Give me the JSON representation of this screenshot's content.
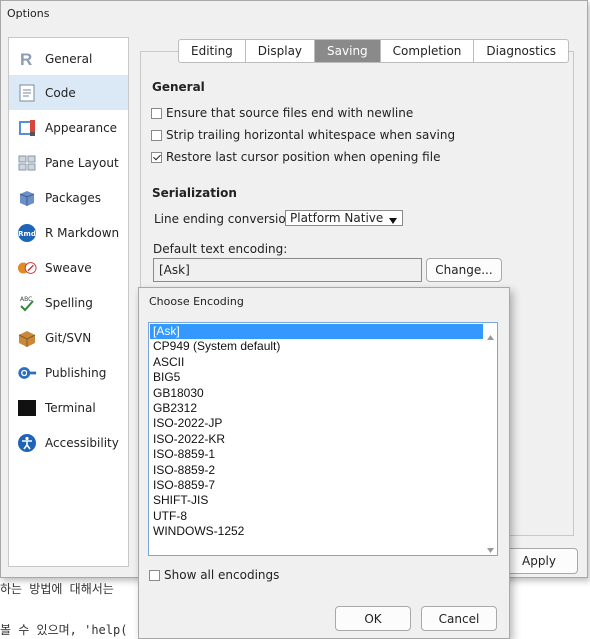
{
  "background": {
    "line1": "하는 방법에 대해서는",
    "line2": "볼 수 있으며, 'help("
  },
  "options": {
    "title": "Options",
    "sidebar": [
      {
        "label": "General",
        "icon": "r-logo-icon"
      },
      {
        "label": "Code",
        "icon": "code-document-icon"
      },
      {
        "label": "Appearance",
        "icon": "appearance-icon"
      },
      {
        "label": "Pane Layout",
        "icon": "pane-layout-icon"
      },
      {
        "label": "Packages",
        "icon": "packages-icon"
      },
      {
        "label": "R Markdown",
        "icon": "rmd-icon"
      },
      {
        "label": "Sweave",
        "icon": "sweave-icon"
      },
      {
        "label": "Spelling",
        "icon": "spelling-icon"
      },
      {
        "label": "Git/SVN",
        "icon": "git-svn-icon"
      },
      {
        "label": "Publishing",
        "icon": "publishing-icon"
      },
      {
        "label": "Terminal",
        "icon": "terminal-icon"
      },
      {
        "label": "Accessibility",
        "icon": "accessibility-icon"
      }
    ],
    "active_sidebar": "Code",
    "tabs": [
      "Editing",
      "Display",
      "Saving",
      "Completion",
      "Diagnostics"
    ],
    "active_tab": "Saving",
    "general": {
      "heading": "General",
      "checkboxes": [
        {
          "label": "Ensure that source files end with newline",
          "checked": false
        },
        {
          "label": "Strip trailing horizontal whitespace when saving",
          "checked": false
        },
        {
          "label": "Restore last cursor position when opening file",
          "checked": true
        }
      ]
    },
    "serialization": {
      "heading": "Serialization",
      "line_ending_label": "Line ending conversion:",
      "line_ending_value": "Platform Native",
      "encoding_label": "Default text encoding:",
      "encoding_value": "[Ask]",
      "change_label": "Change..."
    },
    "apply_label": "Apply"
  },
  "encoding_dialog": {
    "title": "Choose Encoding",
    "items": [
      "[Ask]",
      "CP949 (System default)",
      "ASCII",
      "BIG5",
      "GB18030",
      "GB2312",
      "ISO-2022-JP",
      "ISO-2022-KR",
      "ISO-8859-1",
      "ISO-8859-2",
      "ISO-8859-7",
      "SHIFT-JIS",
      "UTF-8",
      "WINDOWS-1252"
    ],
    "selected": "[Ask]",
    "show_all_label": "Show all encodings",
    "show_all_checked": false,
    "ok_label": "OK",
    "cancel_label": "Cancel"
  },
  "colors": {
    "selection": "#3399ff",
    "active_sidebar": "#dbe9f7",
    "active_tab": "#8a8a8a",
    "list_border": "#7ba6d6"
  }
}
